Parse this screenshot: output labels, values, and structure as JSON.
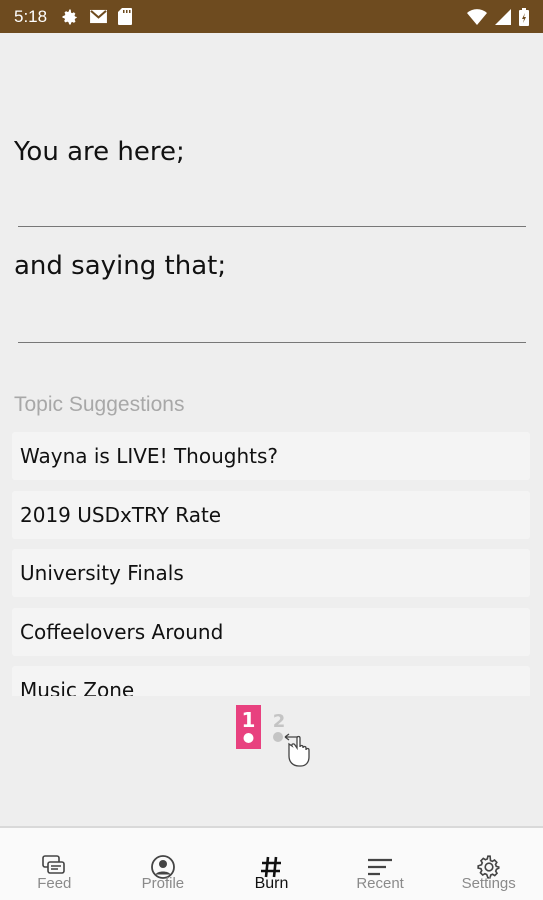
{
  "status_bar": {
    "time": "5:18",
    "left_icons": [
      "gear-icon",
      "gmail-icon",
      "sd-card-icon"
    ],
    "right_icons": [
      "wifi-icon",
      "signal-icon",
      "battery-icon"
    ],
    "background": "#6e4b1f"
  },
  "form": {
    "location_prompt": "You are here;",
    "location_value": "",
    "saying_prompt": "and saying that;",
    "saying_value": ""
  },
  "topics": {
    "header": "Topic Suggestions",
    "items": [
      "Wayna is LIVE! Thoughts?",
      "2019 USDxTRY Rate",
      "University Finals",
      "Coffeelovers Around",
      "Music Zone"
    ]
  },
  "pager": {
    "current": "1",
    "next": "2",
    "accent": "#e8417f"
  },
  "bottom_nav": {
    "items": [
      {
        "label": "Feed",
        "icon": "feed-icon"
      },
      {
        "label": "Profile",
        "icon": "profile-icon"
      },
      {
        "label": "Burn",
        "icon": "hashtag-icon",
        "active": true
      },
      {
        "label": "Recent",
        "icon": "recent-icon"
      },
      {
        "label": "Settings",
        "icon": "settings-icon"
      }
    ]
  }
}
